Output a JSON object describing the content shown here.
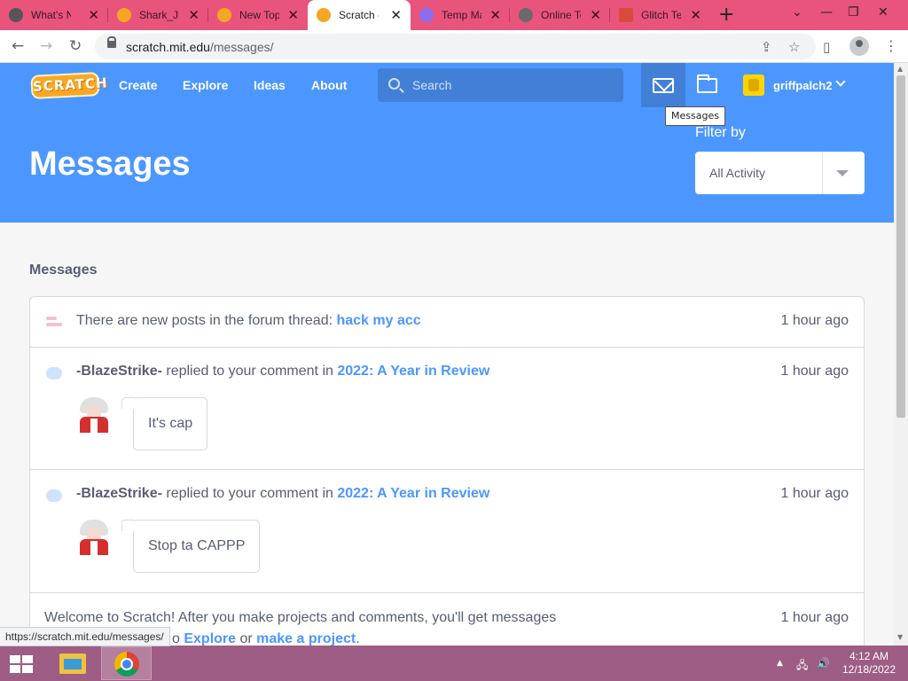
{
  "browser": {
    "tabs": [
      {
        "title": "What's N",
        "favicon_color": "#555555"
      },
      {
        "title": "Shark_JU",
        "favicon_color": "#f5a623"
      },
      {
        "title": "New Top",
        "favicon_color": "#f5a623"
      },
      {
        "title": "Scratch -",
        "favicon_color": "#f5a623",
        "active": true
      },
      {
        "title": "Temp Ma",
        "favicon_color": "#8e6cf0"
      },
      {
        "title": "Online Te",
        "favicon_color": "#6a6a6a"
      },
      {
        "title": "Glitch Te",
        "favicon_color": "#d84a3a"
      }
    ],
    "new_tab": "+",
    "url_host": "scratch.mit.edu",
    "url_path": "/messages/",
    "status_url": "https://scratch.mit.edu/messages/"
  },
  "nav": {
    "logo": "SCRATCH",
    "links": [
      "Create",
      "Explore",
      "Ideas",
      "About"
    ],
    "search_placeholder": "Search",
    "username": "griffpalch2",
    "tooltip": "Messages",
    "accent_color": "#4c97ff"
  },
  "banner": {
    "title": "Messages",
    "filter_label": "Filter by",
    "filter_value": "All Activity"
  },
  "messages": {
    "section_title": "Messages",
    "items": [
      {
        "type": "forum",
        "prefix": "There are new posts in the forum thread: ",
        "link": "hack my acc",
        "time": "1 hour ago"
      },
      {
        "type": "comment",
        "user": "-BlazeStrike-",
        "middle": " replied to your comment in ",
        "link": "2022: A Year in Review",
        "comment": "It's cap",
        "time": "1 hour ago"
      },
      {
        "type": "comment",
        "user": "-BlazeStrike-",
        "middle": " replied to your comment in ",
        "link": "2022: A Year in Review",
        "comment": "Stop ta CAPPP",
        "time": "1 hour ago"
      },
      {
        "type": "welcome",
        "text": "Welcome to Scratch! After you make projects and comments, you'll get messages",
        "line2_pre": "o ",
        "link1": "Explore",
        "or": " or ",
        "link2": "make a project",
        "end": ".",
        "time": "1 hour ago"
      }
    ]
  },
  "taskbar": {
    "time": "4:12 AM",
    "date": "12/18/2022"
  }
}
